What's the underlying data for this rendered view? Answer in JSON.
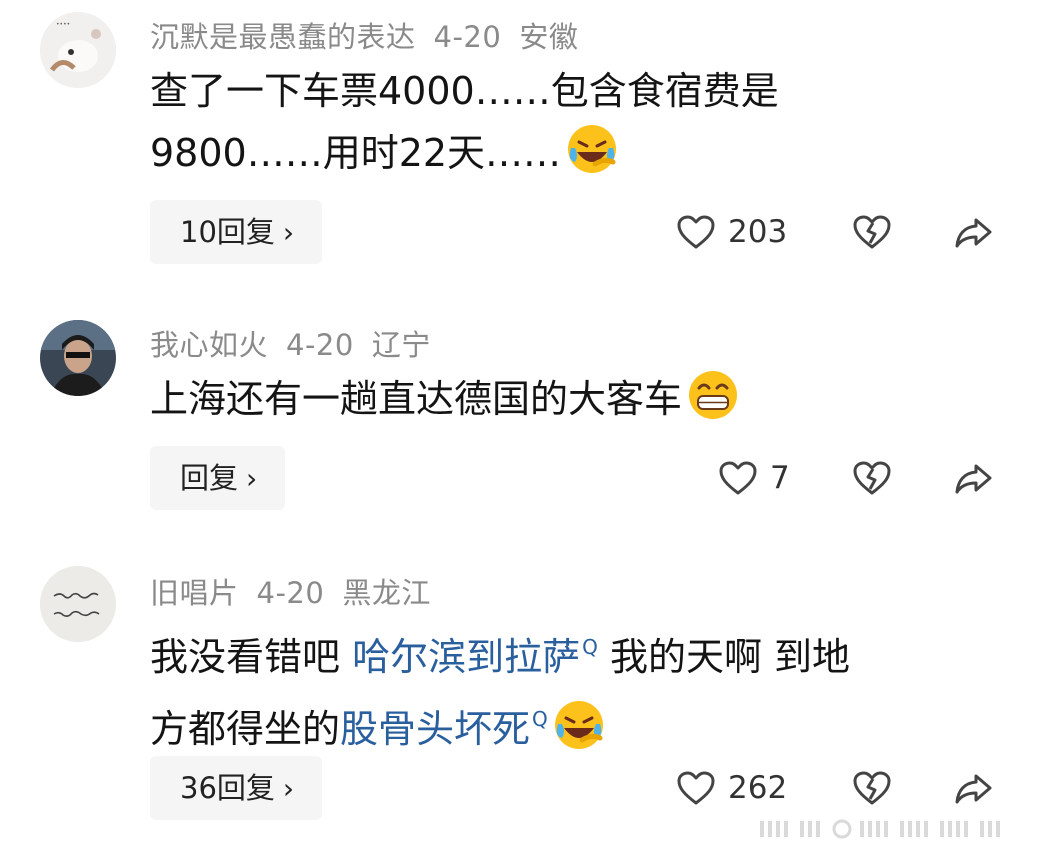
{
  "comments": [
    {
      "username": "沉默是最愚蠢的表达",
      "date": "4-20",
      "location": "安徽",
      "text_line1": "查了一下车票4000……包含食宿费是",
      "text_line2": "9800……用时22天……",
      "emoji": "laughing-crying-emoji",
      "reply_label": "10回复",
      "likes": "203"
    },
    {
      "username": "我心如火",
      "date": "4-20",
      "location": "辽宁",
      "text_line1": "上海还有一趟直达德国的大客车",
      "emoji": "grinning-emoji",
      "reply_label": "回复",
      "likes": "7"
    },
    {
      "username": "旧唱片",
      "date": "4-20",
      "location": "黑龙江",
      "text_line1_a": "我没看错吧 ",
      "text_line1_link": "哈尔滨到拉萨",
      "text_line1_b": " 我的天啊 到地",
      "text_line2_a": "方都得坐的",
      "text_line2_link": "股骨头坏死",
      "emoji": "laughing-crying-emoji",
      "reply_label": "36回复",
      "likes": "262"
    }
  ],
  "icons": {
    "chevron": "›",
    "link_search_glyph": "Q"
  },
  "colors": {
    "link": "#2a5f9e",
    "meta": "#8a8a8a",
    "reply_bg": "#f5f5f5"
  }
}
